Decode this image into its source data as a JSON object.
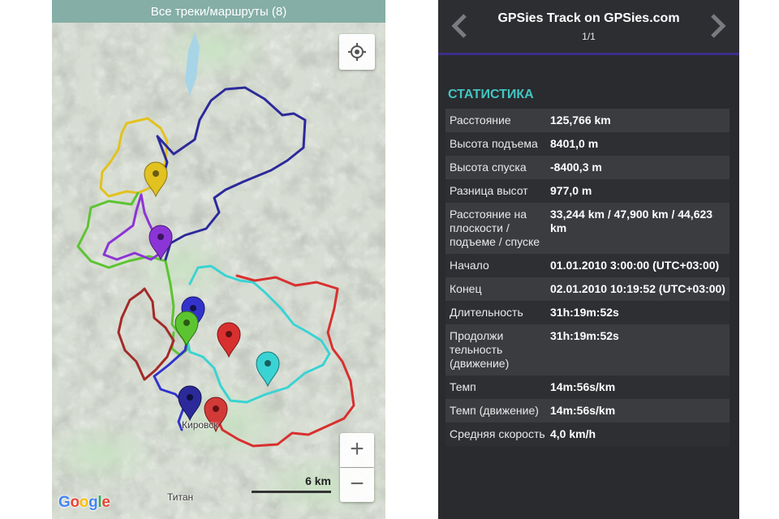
{
  "map_screen": {
    "header_title": "Все треки/маршруты (8)",
    "scale_label": "6 km",
    "zoom_in_label": "+",
    "zoom_out_label": "−",
    "google_logo": [
      {
        "ch": "G",
        "color": "#4285f4"
      },
      {
        "ch": "o",
        "color": "#ea4335"
      },
      {
        "ch": "o",
        "color": "#fbbc05"
      },
      {
        "ch": "g",
        "color": "#4285f4"
      },
      {
        "ch": "l",
        "color": "#34a853"
      },
      {
        "ch": "e",
        "color": "#ea4335"
      }
    ],
    "places": {
      "kirovsk": "Кировск",
      "titan": "Титан"
    },
    "locate_icon": "my-location-icon",
    "track_colors": {
      "yellow": "#e2c21f",
      "green": "#5cc431",
      "purple": "#8c35d6",
      "navy": "#2c2a9a",
      "cyan": "#3ad3d3",
      "red": "#d8302f",
      "darkred": "#a32a28",
      "blue": "#3333cc"
    }
  },
  "stats_screen": {
    "title": "GPSies Track on GPSies.com",
    "page_indicator": "1/1",
    "prev_icon": "chevron-left-icon",
    "next_icon": "chevron-right-icon",
    "section_title": "СТАТИСТИКА",
    "rows": [
      {
        "label": "Расстояние",
        "value": "125,766 km"
      },
      {
        "label": "Высота подъема",
        "value": "8401,0 m"
      },
      {
        "label": "Высота спуска",
        "value": "-8400,3 m"
      },
      {
        "label": "Разница высот",
        "value": "977,0 m"
      },
      {
        "label": "Расстояние на плоскости / подъеме / спуске",
        "value": "33,244 km / 47,900 km / 44,623 km"
      },
      {
        "label": "Начало",
        "value": "01.01.2010 3:00:00 (UTC+03:00)"
      },
      {
        "label": "Конец",
        "value": "02.01.2010 10:19:52 (UTC+03:00)"
      },
      {
        "label": "Длительность",
        "value": "31h:19m:52s"
      },
      {
        "label": "Продолжи тельность (движение)",
        "value": "31h:19m:52s"
      },
      {
        "label": "Темп",
        "value": "14m:56s/km"
      },
      {
        "label": "Темп (движение)",
        "value": "14m:56s/km"
      },
      {
        "label": "Средняя скорость",
        "value": "4,0 km/h"
      }
    ]
  }
}
